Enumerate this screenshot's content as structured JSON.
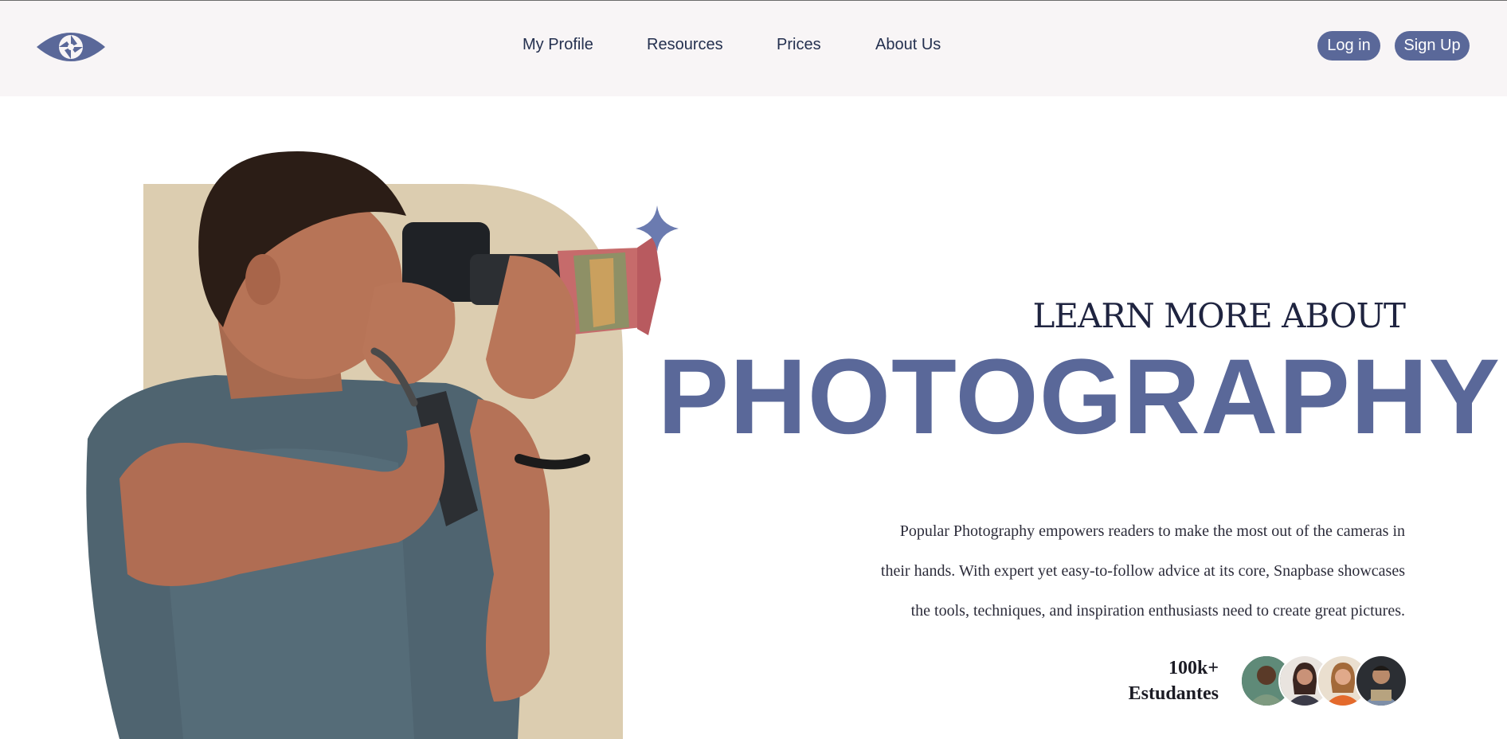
{
  "nav": {
    "logo_name": "eye-aperture-logo",
    "links": [
      "My Profile",
      "Resources",
      "Prices",
      "About Us"
    ],
    "login_label": "Log in",
    "signup_label": "Sign Up"
  },
  "hero": {
    "kicker": "LEARN MORE ABOUT",
    "headline": "PHOTOGRAPHY",
    "description_lines": [
      "Popular Photography empowers readers to make the most out of the cameras in",
      "their hands. With expert yet easy-to-follow advice at its core, Snapbase showcases",
      "the tools, techniques, and inspiration enthusiasts need to create great pictures."
    ],
    "stat_value": "100k+",
    "stat_label": "Estudantes"
  },
  "colors": {
    "accent": "#5a6899",
    "nav_bg": "#f8f5f6",
    "arch": "#dccdb0",
    "text_dark": "#1f2440"
  }
}
